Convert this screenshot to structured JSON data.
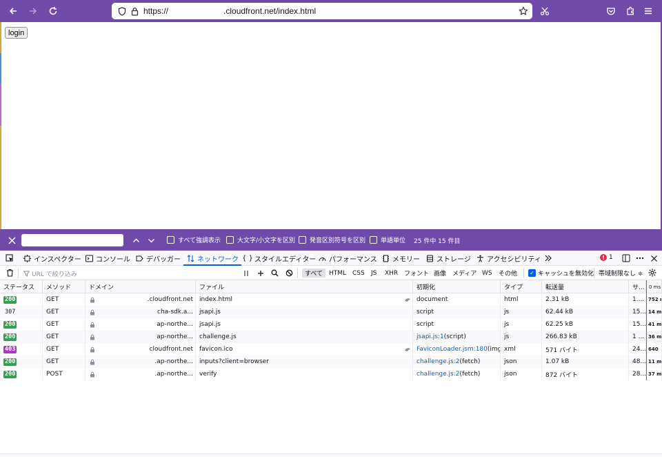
{
  "browser": {
    "url_prefix": "https://",
    "url_suffix": ".cloudfront.net/index.html"
  },
  "page": {
    "login_label": "login"
  },
  "findbar": {
    "options": [
      "すべて強調表示",
      "大文字/小文字を区別",
      "発音区別符号を区別",
      "単語単位"
    ],
    "count": "25 件中 15 件目"
  },
  "devtools": {
    "tabs": [
      "インスペクター",
      "コンソール",
      "デバッガー",
      "ネットワーク",
      "スタイルエディター",
      "パフォーマンス",
      "メモリー",
      "ストレージ",
      "アクセシビリティ"
    ],
    "active_tab": "ネットワーク",
    "error_count": "1"
  },
  "filterbar": {
    "placeholder": "URL で絞り込み",
    "types": [
      "すべて",
      "HTML",
      "CSS",
      "JS",
      "XHR",
      "フォント",
      "画像",
      "メディア",
      "WS",
      "その他"
    ],
    "disable_cache": "キャッシュを無効化",
    "throttle": "帯域制限なし ≑"
  },
  "table": {
    "columns": [
      "ステータス",
      "メソッド",
      "ドメイン",
      "ファイル",
      "初期化",
      "タイプ",
      "転送量",
      "サ...",
      "0 ms"
    ],
    "rows": [
      {
        "status": "200",
        "method": "GET",
        "domain": ".cloudfront.net",
        "file": "index.html",
        "init": "document",
        "init_link": "",
        "type": "html",
        "transfer": "2.31 kB",
        "size": "1....",
        "time": "752 m",
        "tracker": true
      },
      {
        "status": "307",
        "method": "GET",
        "domain": "cha-sdk.a...",
        "file": "jsapi.js",
        "init": "script",
        "init_link": "",
        "type": "js",
        "transfer": "62.44 kB",
        "size": "15...",
        "time": "14 m",
        "tracker": false
      },
      {
        "status": "200",
        "method": "GET",
        "domain": "ap-northe...",
        "file": "jsapi.js",
        "init": "script",
        "init_link": "",
        "type": "js",
        "transfer": "62.25 kB",
        "size": "15...",
        "time": "41 m",
        "tracker": false
      },
      {
        "status": "200",
        "method": "GET",
        "domain": "ap-northe...",
        "file": "challenge.js",
        "init": " (script)",
        "init_link": "jsapi.js:1",
        "type": "js",
        "transfer": "266.83 kB",
        "size": "1 ...",
        "time": "36 m",
        "tracker": false
      },
      {
        "status": "403",
        "method": "GET",
        "domain": "cloudfront.net",
        "file": "favicon.ico",
        "init": " (img)",
        "init_link": "FaviconLoader.jsm:180",
        "type": "xml",
        "transfer": "571 バイト",
        "size": "24...",
        "time": "640",
        "tracker": true
      },
      {
        "status": "200",
        "method": "GET",
        "domain": ".ap-northe...",
        "file": "inputs?client=browser",
        "init": " (fetch)",
        "init_link": "challenge.js:2",
        "type": "json",
        "transfer": "1.07 kB",
        "size": "48...",
        "time": "11 m",
        "tracker": false
      },
      {
        "status": "200",
        "method": "POST",
        "domain": ".ap-northe...",
        "file": "verify",
        "init": " (fetch)",
        "init_link": "challenge.js:2",
        "type": "json",
        "transfer": "872 バイト",
        "size": "28...",
        "time": "37 m",
        "tracker": false
      }
    ]
  }
}
